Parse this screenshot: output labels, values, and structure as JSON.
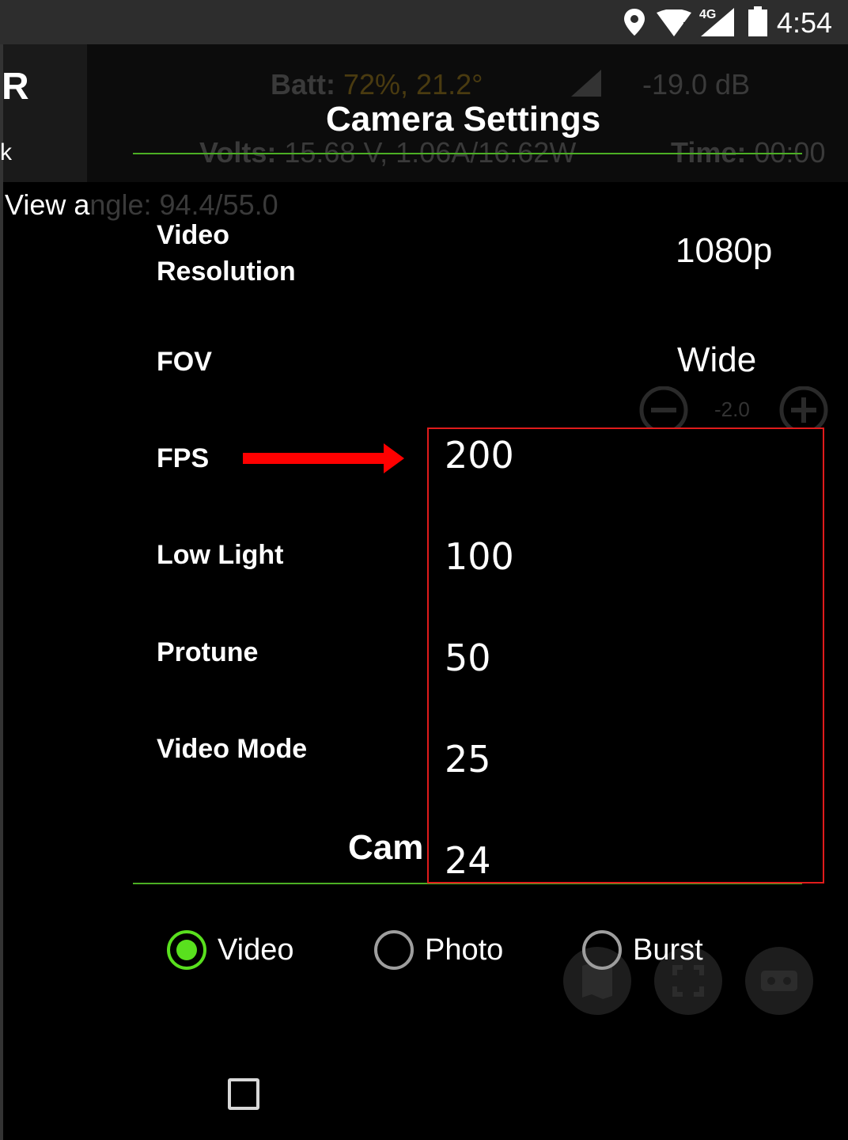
{
  "status_bar": {
    "time": "4:54",
    "network": "4G",
    "icons": [
      "location-icon",
      "wifi-icon",
      "cell-signal-icon",
      "battery-icon"
    ]
  },
  "background": {
    "left_letter": "R",
    "left_small": "k",
    "batt_label": "Batt:",
    "batt_value": "72%, 21.2°",
    "signal_db": "-19.0 dB",
    "volts_label": "Volts:",
    "volts_value": "15.68 V, 1.06A/16.62W",
    "time_label": "Time:",
    "time_value": "00:00",
    "view_visible": "View a",
    "view_dim": "ngle: 94.4/55.0",
    "ev_value": "-2.0"
  },
  "dialog": {
    "title": "Camera Settings",
    "rows": [
      {
        "label_line1": "Video",
        "label_line2": "Resolution",
        "value": "1080p"
      },
      {
        "label": "FOV",
        "value": "Wide"
      },
      {
        "label": "FPS"
      },
      {
        "label": "Low Light"
      },
      {
        "label": "Protune"
      },
      {
        "label": "Video Mode"
      }
    ],
    "cam_heading": "Cam",
    "fps_options": [
      "200",
      "100",
      "50",
      "25",
      "24"
    ],
    "modes": [
      {
        "label": "Video",
        "selected": true
      },
      {
        "label": "Photo",
        "selected": false
      },
      {
        "label": "Burst",
        "selected": false
      }
    ]
  },
  "colors": {
    "accent_green": "#59e01e",
    "divider_green": "#4caf24",
    "highlight_red": "#e01b1b"
  }
}
